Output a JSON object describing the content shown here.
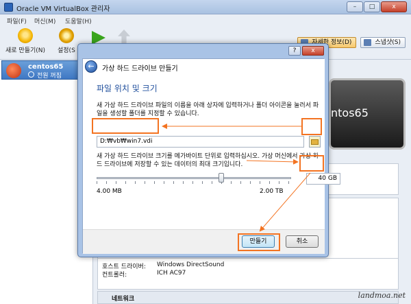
{
  "window": {
    "title": "Oracle VM VirtualBox 관리자",
    "min": "–",
    "max": "□",
    "close": "x"
  },
  "menu": [
    "파일(F)",
    "머신(M)",
    "도움말(H)"
  ],
  "toolbar": {
    "new_label": "새로 만들기(N)",
    "settings_label": "설정(S"
  },
  "right_tabs": {
    "details": "자세한 정보(D)",
    "snapshots": "스냅샷(S)"
  },
  "vm": {
    "name": "centos65",
    "state": "전원 꺼짐"
  },
  "preview_text": "ntos65",
  "details": {
    "audio_driver_label": "호스트 드라이버:",
    "audio_driver_value": "Windows DirectSound",
    "controller_label": "컨트롤러:",
    "controller_value": "ICH AC97",
    "next_section": "네트워크"
  },
  "dialog": {
    "title": "가상 하드 드라이브 만들기",
    "help": "?",
    "close": "x",
    "back": "←",
    "heading": "파일 위치 및 크기",
    "location_desc": "새 가상 하드 드라이브 파일의 이름을 아래 상자에 입력하거나 폴더 아이콘을 눌러서 파일을 생성할 폴더를 지정할 수 있습니다.",
    "path_value": "D:₩vb₩win7.vdi",
    "size_desc": "새 가상 하드 드라이브 크기를 메가바이트 단위로 입력하십시오. 가상 머신에서 가상 하드 드라이브에 저장할 수 있는 데이터의 최대 크기입니다.",
    "size_value": "40 GB",
    "slider": {
      "min_label": "4.00 MB",
      "max_label": "2.00 TB",
      "position": 0.64
    },
    "create_button": "만들기",
    "cancel_button": "취소"
  },
  "watermark": "landmoa.net",
  "colors": {
    "accent": "#f37321",
    "heading": "#1f4e9c",
    "selected": "#3f78c4"
  }
}
